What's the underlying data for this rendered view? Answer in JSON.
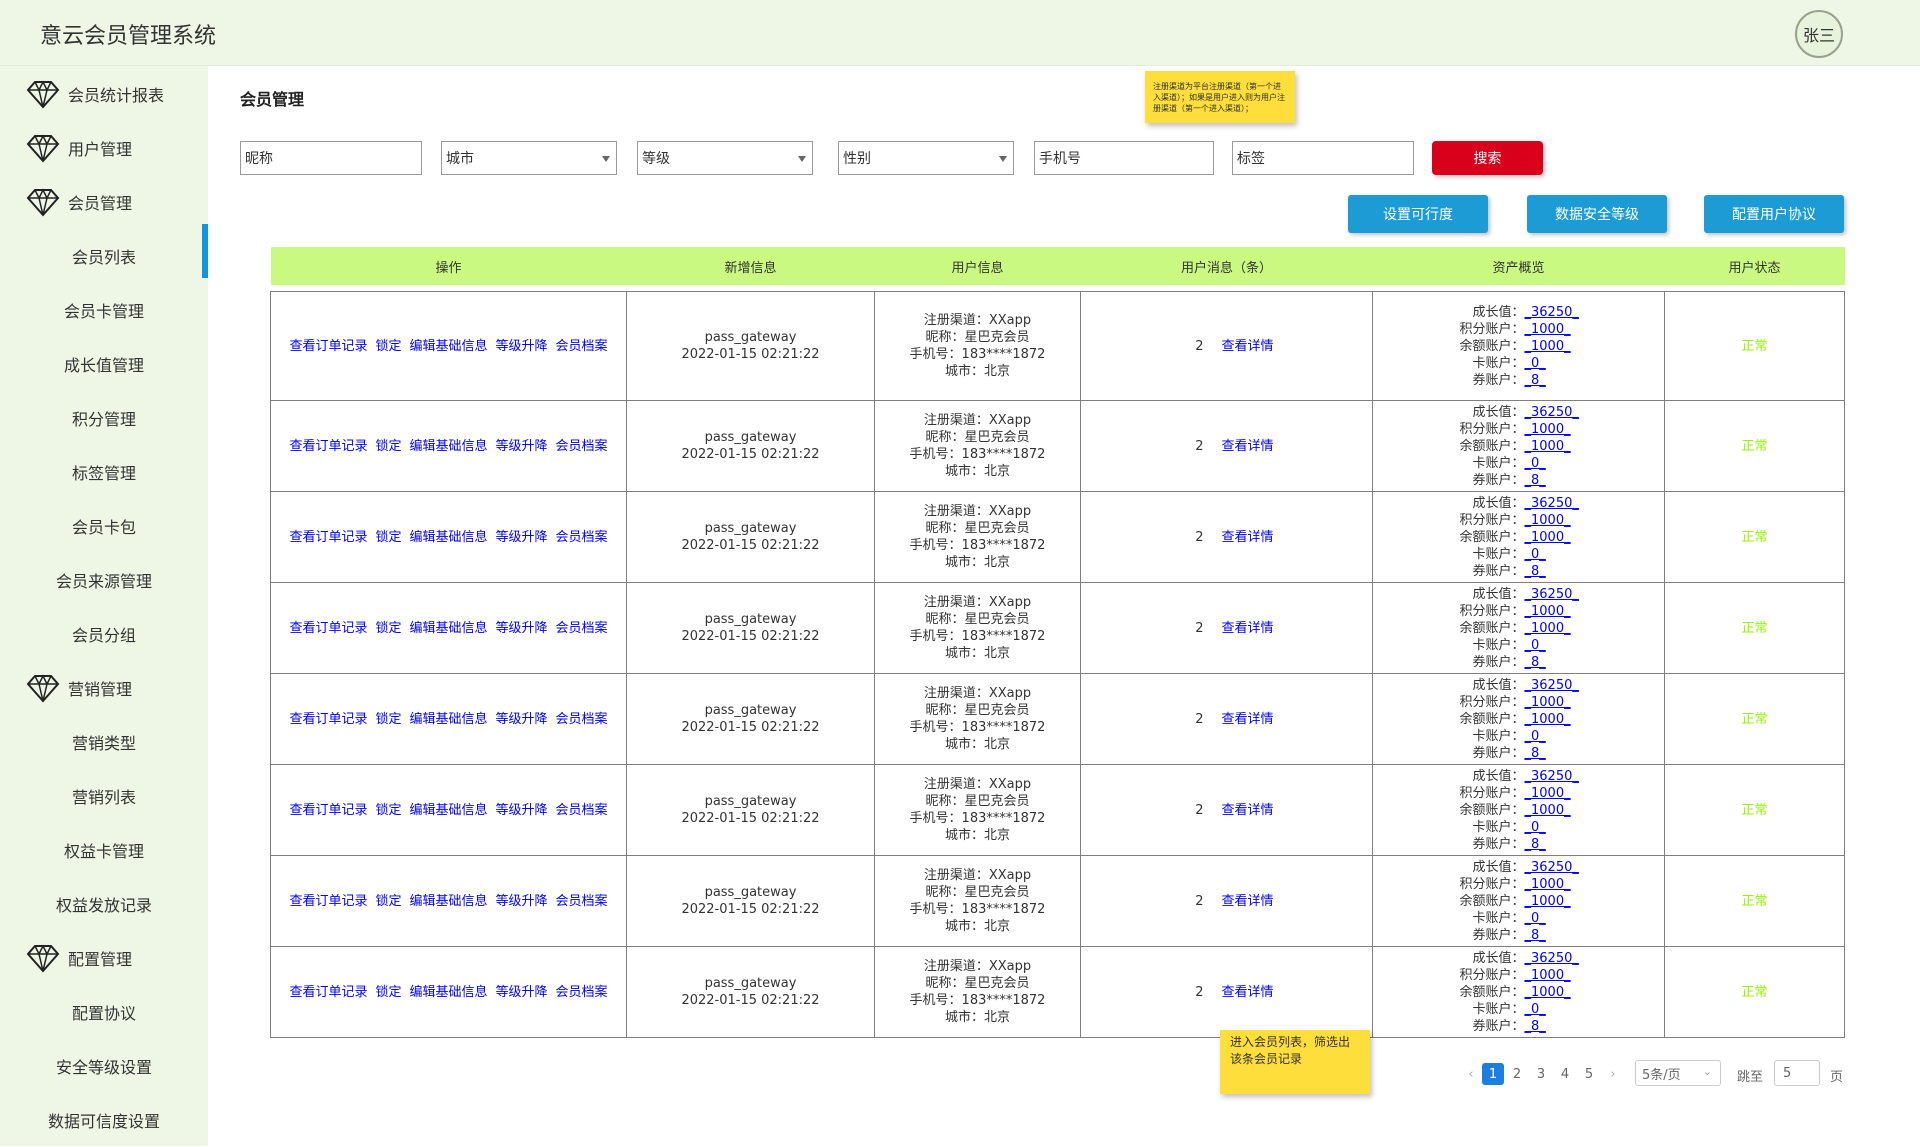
{
  "app": {
    "title": "意云会员管理系统",
    "user": "张三"
  },
  "sidebar": [
    {
      "label": "会员统计报表",
      "type": "parent"
    },
    {
      "label": "用户管理",
      "type": "parent"
    },
    {
      "label": "会员管理",
      "type": "parent"
    },
    {
      "label": "会员列表",
      "type": "child",
      "active": true
    },
    {
      "label": "会员卡管理",
      "type": "child"
    },
    {
      "label": "成长值管理",
      "type": "child"
    },
    {
      "label": "积分管理",
      "type": "child"
    },
    {
      "label": "标签管理",
      "type": "child"
    },
    {
      "label": "会员卡包",
      "type": "child"
    },
    {
      "label": "会员来源管理",
      "type": "child"
    },
    {
      "label": "会员分组",
      "type": "child"
    },
    {
      "label": "营销管理",
      "type": "parent"
    },
    {
      "label": "营销类型",
      "type": "child"
    },
    {
      "label": "营销列表",
      "type": "child"
    },
    {
      "label": "权益卡管理",
      "type": "child"
    },
    {
      "label": "权益发放记录",
      "type": "child"
    },
    {
      "label": "配置管理",
      "type": "parent"
    },
    {
      "label": "配置协议",
      "type": "child"
    },
    {
      "label": "安全等级设置",
      "type": "child"
    },
    {
      "label": "数据可信度设置",
      "type": "child"
    }
  ],
  "page": {
    "title": "会员管理"
  },
  "notes": {
    "top": "注册渠道为平台注册渠道（第一个进入渠道）；如果是用户进入则为用户注册渠道（第一个进入渠道）；",
    "bottom": "进入会员列表，筛选出该条会员记录"
  },
  "filters": {
    "nickname": "昵称",
    "city": "城市",
    "level": "等级",
    "gender": "性别",
    "phone": "手机号",
    "tag": "标签",
    "search_label": "搜索"
  },
  "actions": {
    "set_credibility": "设置可行度",
    "data_security_level": "数据安全等级",
    "configure_agreement": "配置用户协议"
  },
  "table": {
    "headers": [
      "操作",
      "新增信息",
      "用户信息",
      "用户消息（条）",
      "资产概览",
      "用户状态"
    ],
    "op_links": [
      "查看订单记录",
      "锁定",
      "编辑基础信息",
      "等级升降",
      "会员档案"
    ],
    "rows": [
      {
        "new_info": [
          "pass_gateway",
          "2022-01-15 02:21:22"
        ],
        "user_info": [
          "注册渠道：XXapp",
          "昵称：星巴克会员",
          "手机号：183****1872",
          "城市：北京"
        ],
        "msg_count": "2",
        "msg_link": "查看详情",
        "assets": [
          [
            "成长值：",
            "_36250_"
          ],
          [
            "积分账户：",
            "_1000_"
          ],
          [
            "余额账户：",
            "_1000_"
          ],
          [
            "卡账户：",
            "_0_"
          ],
          [
            "券账户：",
            "_8_"
          ]
        ],
        "status": "正常"
      },
      {
        "new_info": [
          "pass_gateway",
          "2022-01-15 02:21:22"
        ],
        "user_info": [
          "注册渠道：XXapp",
          "昵称：星巴克会员",
          "手机号：183****1872",
          "城市：北京"
        ],
        "msg_count": "2",
        "msg_link": "查看详情",
        "assets": [
          [
            "成长值：",
            "_36250_"
          ],
          [
            "积分账户：",
            "_1000_"
          ],
          [
            "余额账户：",
            "_1000_"
          ],
          [
            "卡账户：",
            "_0_"
          ],
          [
            "券账户：",
            "_8_"
          ]
        ],
        "status": "正常"
      },
      {
        "new_info": [
          "pass_gateway",
          "2022-01-15 02:21:22"
        ],
        "user_info": [
          "注册渠道：XXapp",
          "昵称：星巴克会员",
          "手机号：183****1872",
          "城市：北京"
        ],
        "msg_count": "2",
        "msg_link": "查看详情",
        "assets": [
          [
            "成长值：",
            "_36250_"
          ],
          [
            "积分账户：",
            "_1000_"
          ],
          [
            "余额账户：",
            "_1000_"
          ],
          [
            "卡账户：",
            "_0_"
          ],
          [
            "券账户：",
            "_8_"
          ]
        ],
        "status": "正常"
      },
      {
        "new_info": [
          "pass_gateway",
          "2022-01-15 02:21:22"
        ],
        "user_info": [
          "注册渠道：XXapp",
          "昵称：星巴克会员",
          "手机号：183****1872",
          "城市：北京"
        ],
        "msg_count": "2",
        "msg_link": "查看详情",
        "assets": [
          [
            "成长值：",
            "_36250_"
          ],
          [
            "积分账户：",
            "_1000_"
          ],
          [
            "余额账户：",
            "_1000_"
          ],
          [
            "卡账户：",
            "_0_"
          ],
          [
            "券账户：",
            "_8_"
          ]
        ],
        "status": "正常"
      },
      {
        "new_info": [
          "pass_gateway",
          "2022-01-15 02:21:22"
        ],
        "user_info": [
          "注册渠道：XXapp",
          "昵称：星巴克会员",
          "手机号：183****1872",
          "城市：北京"
        ],
        "msg_count": "2",
        "msg_link": "查看详情",
        "assets": [
          [
            "成长值：",
            "_36250_"
          ],
          [
            "积分账户：",
            "_1000_"
          ],
          [
            "余额账户：",
            "_1000_"
          ],
          [
            "卡账户：",
            "_0_"
          ],
          [
            "券账户：",
            "_8_"
          ]
        ],
        "status": "正常"
      },
      {
        "new_info": [
          "pass_gateway",
          "2022-01-15 02:21:22"
        ],
        "user_info": [
          "注册渠道：XXapp",
          "昵称：星巴克会员",
          "手机号：183****1872",
          "城市：北京"
        ],
        "msg_count": "2",
        "msg_link": "查看详情",
        "assets": [
          [
            "成长值：",
            "_36250_"
          ],
          [
            "积分账户：",
            "_1000_"
          ],
          [
            "余额账户：",
            "_1000_"
          ],
          [
            "卡账户：",
            "_0_"
          ],
          [
            "券账户：",
            "_8_"
          ]
        ],
        "status": "正常"
      },
      {
        "new_info": [
          "pass_gateway",
          "2022-01-15 02:21:22"
        ],
        "user_info": [
          "注册渠道：XXapp",
          "昵称：星巴克会员",
          "手机号：183****1872",
          "城市：北京"
        ],
        "msg_count": "2",
        "msg_link": "查看详情",
        "assets": [
          [
            "成长值：",
            "_36250_"
          ],
          [
            "积分账户：",
            "_1000_"
          ],
          [
            "余额账户：",
            "_1000_"
          ],
          [
            "卡账户：",
            "_0_"
          ],
          [
            "券账户：",
            "_8_"
          ]
        ],
        "status": "正常"
      },
      {
        "new_info": [
          "pass_gateway",
          "2022-01-15 02:21:22"
        ],
        "user_info": [
          "注册渠道：XXapp",
          "昵称：星巴克会员",
          "手机号：183****1872",
          "城市：北京"
        ],
        "msg_count": "2",
        "msg_link": "查看详情",
        "assets": [
          [
            "成长值：",
            "_36250_"
          ],
          [
            "积分账户：",
            "_1000_"
          ],
          [
            "余额账户：",
            "_1000_"
          ],
          [
            "卡账户：",
            "_0_"
          ],
          [
            "券账户：",
            "_8_"
          ]
        ],
        "status": "正常"
      }
    ]
  },
  "pagination": {
    "prev": "‹",
    "next": "›",
    "pages": [
      "1",
      "2",
      "3",
      "4",
      "5"
    ],
    "current": "1",
    "page_size": "5条/页",
    "jump_label": "跳至",
    "jump_value": "5",
    "jump_suffix": "页"
  },
  "colors": {
    "sidebar_bg": "#eef7e6",
    "header_row": "#caf982",
    "primary": "#1c9bd5",
    "danger": "#d9001b",
    "sticky": "#fede3a",
    "status_ok": "#95f204",
    "link": "#0000ff"
  }
}
